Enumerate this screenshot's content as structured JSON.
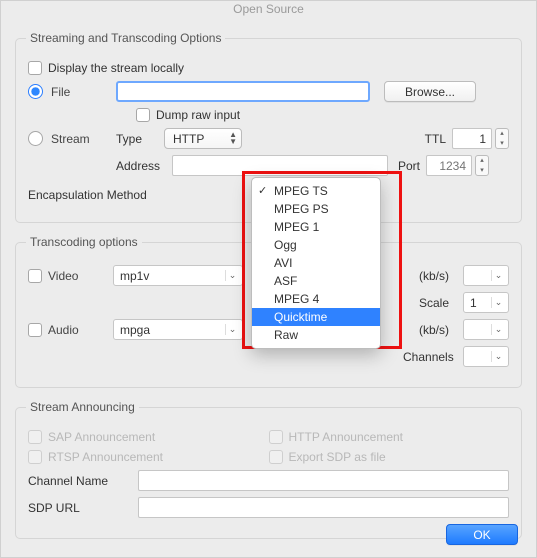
{
  "header": {
    "tab_title": "Open Source"
  },
  "streaming": {
    "legend": "Streaming and Transcoding Options",
    "display_locally_label": "Display the stream locally",
    "file_label": "File",
    "file_value": "",
    "browse_label": "Browse...",
    "dump_raw_label": "Dump raw input",
    "stream_label": "Stream",
    "type_label": "Type",
    "type_value": "HTTP",
    "ttl_label": "TTL",
    "ttl_value": "1",
    "address_label": "Address",
    "address_value": "",
    "port_label": "Port",
    "port_placeholder": "1234",
    "encap_label": "Encapsulation Method",
    "encap_menu": {
      "selected": "MPEG TS",
      "highlighted": "Quicktime",
      "items": [
        "MPEG TS",
        "MPEG PS",
        "MPEG 1",
        "Ogg",
        "AVI",
        "ASF",
        "MPEG 4",
        "Quicktime",
        "Raw"
      ]
    }
  },
  "transcoding": {
    "legend": "Transcoding options",
    "video_label": "Video",
    "video_codec": "mp1v",
    "video_bitrate": "",
    "kbps_label": "(kb/s)",
    "scale_label": "Scale",
    "scale_value": "1",
    "audio_label": "Audio",
    "audio_codec": "mpga",
    "audio_bitrate": "",
    "channels_label": "Channels",
    "channels_value": ""
  },
  "announce": {
    "legend": "Stream Announcing",
    "sap_label": "SAP Announcement",
    "rtsp_label": "RTSP Announcement",
    "http_label": "HTTP Announcement",
    "export_label": "Export SDP as file",
    "channel_name_label": "Channel Name",
    "channel_name_value": "",
    "sdp_url_label": "SDP URL",
    "sdp_url_value": ""
  },
  "footer": {
    "ok_label": "OK"
  }
}
